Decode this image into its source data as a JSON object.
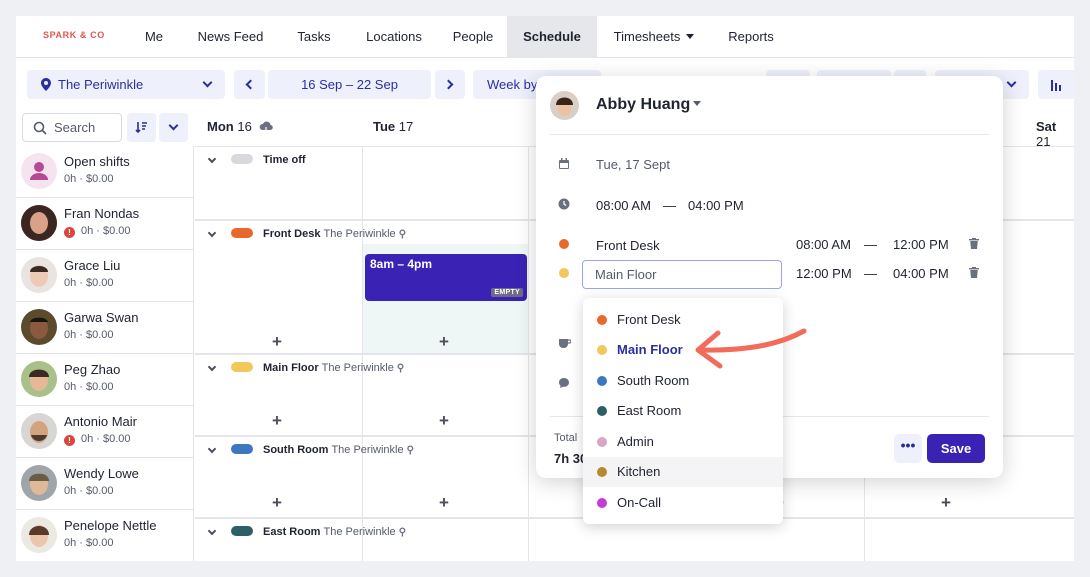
{
  "brand": "SPARK & CO",
  "nav": {
    "items": [
      "Me",
      "News Feed",
      "Tasks",
      "Locations",
      "People",
      "Schedule",
      "Timesheets",
      "Reports"
    ]
  },
  "toolbar": {
    "location": "The Periwinkle",
    "date_range": "16 Sep – 22 Sep",
    "view": "Week by"
  },
  "search": {
    "placeholder": "Search"
  },
  "days": [
    {
      "name": "Mon",
      "num": "16"
    },
    {
      "name": "Tue",
      "num": "17"
    },
    {
      "name": "Sat",
      "num": "21"
    }
  ],
  "employees": [
    {
      "name": "Open shifts",
      "sub": "0h · $0.00",
      "warn": false
    },
    {
      "name": "Fran Nondas",
      "sub": "0h · $0.00",
      "warn": true
    },
    {
      "name": "Grace Liu",
      "sub": "0h · $0.00",
      "warn": false
    },
    {
      "name": "Garwa Swan",
      "sub": "0h · $0.00",
      "warn": false
    },
    {
      "name": "Peg Zhao",
      "sub": "0h · $0.00",
      "warn": false
    },
    {
      "name": "Antonio Mair",
      "sub": "0h · $0.00",
      "warn": true
    },
    {
      "name": "Wendy Lowe",
      "sub": "0h · $0.00",
      "warn": false
    },
    {
      "name": "Penelope Nettle",
      "sub": "0h · $0.00",
      "warn": false
    }
  ],
  "sections": [
    {
      "title": "Time off",
      "loc": "",
      "color": "#d8d9de"
    },
    {
      "title": "Front Desk",
      "loc": "The Periwinkle",
      "color": "#e8692c"
    },
    {
      "title": "Main Floor",
      "loc": "The Periwinkle",
      "color": "#f2c75b"
    },
    {
      "title": "South Room",
      "loc": "The Periwinkle",
      "color": "#3f76c0"
    },
    {
      "title": "East Room",
      "loc": "The Periwinkle",
      "color": "#2c5f66"
    }
  ],
  "shift": {
    "time": "8am – 4pm",
    "badge": "EMPTY"
  },
  "popup": {
    "name": "Abby Huang",
    "date": "Tue, 17 Sept",
    "start": "08:00 AM",
    "end": "04:00 PM",
    "dash": "—",
    "rows": [
      {
        "area": "Front Desk",
        "start": "08:00 AM",
        "end": "12:00 PM",
        "color": "#e8692c"
      },
      {
        "area": "Main Floor",
        "start": "12:00 PM",
        "end": "04:00 PM",
        "color": "#f2c75b"
      }
    ],
    "total_label": "Total",
    "total_value": "7h 30",
    "more": "•••",
    "save": "Save"
  },
  "dropdown": [
    {
      "label": "Front Desk",
      "color": "#e8692c"
    },
    {
      "label": "Main Floor",
      "color": "#f2c75b"
    },
    {
      "label": "South Room",
      "color": "#3f76c0"
    },
    {
      "label": "East Room",
      "color": "#2c5f66"
    },
    {
      "label": "Admin",
      "color": "#d9a6c8"
    },
    {
      "label": "Kitchen",
      "color": "#b58a2e"
    },
    {
      "label": "On-Call",
      "color": "#c43ad8"
    }
  ]
}
